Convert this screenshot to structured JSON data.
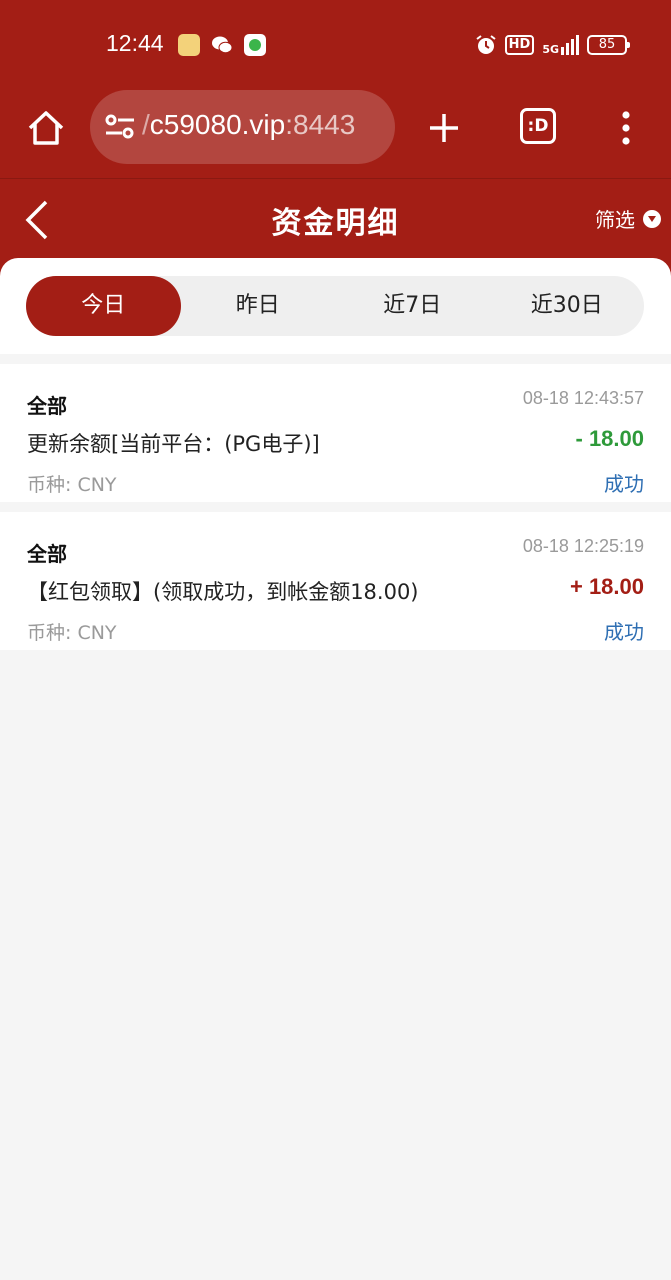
{
  "status_bar": {
    "time": "12:44",
    "hd": "HD",
    "network": "5G",
    "battery": "85"
  },
  "browser": {
    "url_fade": "/",
    "url_main": "c59080.vip",
    "url_port": ":8443",
    "tab_label": ":D"
  },
  "header": {
    "title": "资金明细",
    "filter_label": "筛选"
  },
  "tabs": [
    {
      "label": "今日",
      "active": true
    },
    {
      "label": "昨日",
      "active": false
    },
    {
      "label": "近7日",
      "active": false
    },
    {
      "label": "近30日",
      "active": false
    }
  ],
  "records": [
    {
      "type": "全部",
      "time": "08-18 12:43:57",
      "description": "更新余额[当前平台：(PG电子)]",
      "amount": "- 18.00",
      "amount_color": "#2e9a3a",
      "currency": "币种: CNY",
      "status": "成功"
    },
    {
      "type": "全部",
      "time": "08-18 12:25:19",
      "description": "【红包领取】(领取成功，到帐金额18.00)",
      "amount": "+ 18.00",
      "amount_color": "#a31e15",
      "currency": "币种: CNY",
      "status": "成功"
    }
  ],
  "colors": {
    "brand": "#a31e15",
    "link": "#2f6fb3"
  }
}
